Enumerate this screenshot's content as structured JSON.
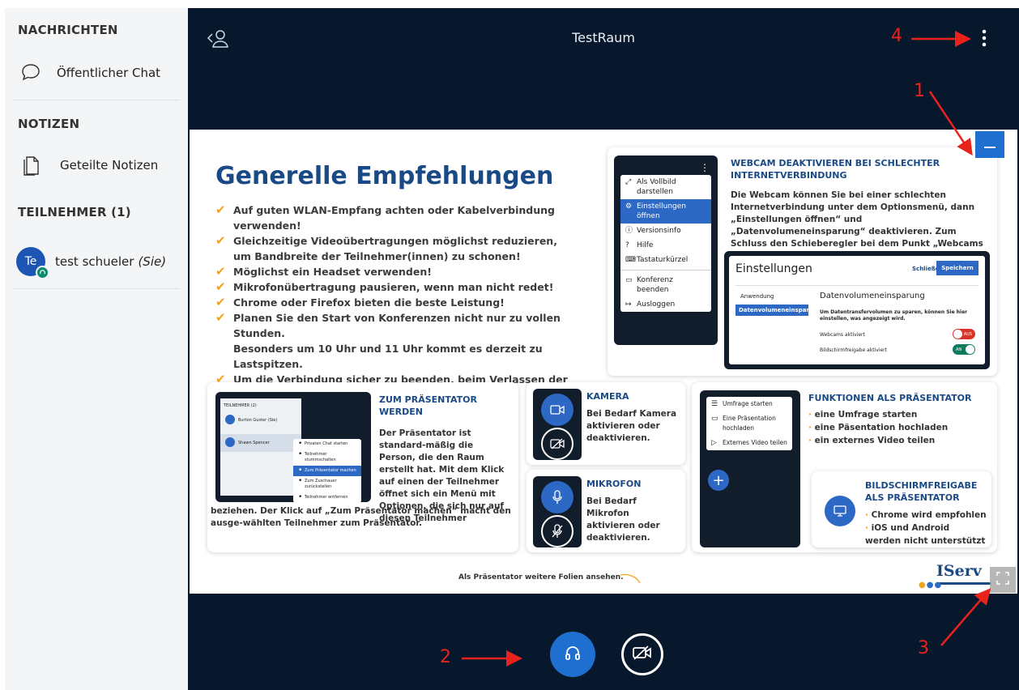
{
  "sidebar": {
    "messages_header": "NACHRICHTEN",
    "public_chat": "Öffentlicher Chat",
    "notes_header": "NOTIZEN",
    "shared_notes": "Geteilte Notizen",
    "participants_header": "TEILNEHMER (1)",
    "user": {
      "initials": "Te",
      "name": "test schueler",
      "you_label": "(Sie)"
    }
  },
  "topbar": {
    "title": "TestRaum"
  },
  "slide": {
    "title": "Generelle Empfehlungen",
    "checklist": [
      "Auf guten WLAN-Empfang achten oder Kabelverbindung verwenden!",
      "Gleichzeitige Videoübertragungen möglichst reduzieren,\num Bandbreite der Teilnehmer(innen) zu schonen!",
      "Möglichst ein Headset verwenden!",
      "Mikrofonübertragung pausieren, wenn man nicht redet!",
      "Chrome oder Firefox bieten die beste Leistung!",
      "Planen Sie den Start von Konferenzen nicht nur zu vollen Stunden.\nBesonders um 10 Uhr und 11 Uhr kommt es derzeit zu Lastspitzen.",
      "Um die Verbindung sicher zu beenden, beim Verlassen der Konferenz\nden Browser-Tab schließen."
    ],
    "webcam_card": {
      "title": "WEBCAM DEAKTIVIEREN BEI SCHLECHTER INTERNETVERBINDUNG",
      "text": "Die Webcam können Sie bei einer schlechten Internetverbindung unter dem Optionsmenü, dann „Einstellungen öffnen“ und „Datenvolumeneinsparung“ deaktivieren. Zum Schluss den Schieberegler bei dem Punkt „Webcams aktiviert“ ausstellen.",
      "menu": [
        "Als Vollbild darstellen",
        "Einstellungen öffnen",
        "Versionsinfo",
        "Hilfe",
        "Tastaturkürzel",
        "Konferenz beenden",
        "Ausloggen"
      ],
      "settings": {
        "title": "Einstellungen",
        "close": "Schließen",
        "save": "Speichern",
        "nav": [
          "Anwendung",
          "Datenvolumeneinspar..."
        ],
        "heading": "Datenvolumeneinsparung",
        "desc": "Um Datentransfervolumen zu sparen, können Sie hier einstellen, was angezeigt wird.",
        "row1": "Webcams aktiviert",
        "row1_state": "AUS",
        "row2": "Bildschirmfreigabe aktiviert",
        "row2_state": "AN"
      }
    },
    "presenter_card": {
      "title": "ZUM PRÄSENTATOR WERDEN",
      "text": "Der Präsentator ist standard-mäßig die Person, die den Raum erstellt hat. Mit dem Klick auf einen der Teilnehmer öffnet sich ein Menü mit Optionen, die sich nur auf diesen Teilnehmer",
      "text2": "beziehen. Der Klick auf „Zum Präsentator machen“ macht den ausge-wählten Teilnehmer zum Präsentator.",
      "mock_header": "TEILNEHMER (2)",
      "mock_users": [
        "Burton Guster (Sie)",
        "Shawn Spencer"
      ],
      "mock_menu": [
        "Privaten Chat starten",
        "Teilnehmer stummschalten",
        "Zum Präsentator machen",
        "Zum Zuschauer zurückstellen",
        "Teilnehmer entfernen"
      ]
    },
    "camera_card": {
      "title": "KAMERA",
      "text": "Bei Bedarf Kamera aktivieren oder deaktivieren."
    },
    "mic_card": {
      "title": "MIKROFON",
      "text": "Bei Bedarf Mikrofon aktivieren oder deaktivieren."
    },
    "functions_card": {
      "title": "FUNKTIONEN ALS PRÄSENTATOR",
      "bullets": [
        "eine Umfrage starten",
        "eine Päsentation hochladen",
        "ein externes Video teilen"
      ],
      "menu": [
        "Umfrage starten",
        "Eine Präsentation hochladen",
        "Externes Video teilen"
      ]
    },
    "screenshare_card": {
      "title": "BILDSCHIRMFREIGABE ALS PRÄSENTATOR",
      "bullets": [
        "Chrome wird empfohlen",
        "iOS und Android werden nicht unterstützt"
      ]
    },
    "footer_note": "Als Präsentator weitere Folien ansehen.",
    "logo": "IServ"
  },
  "annotations": [
    "1",
    "2",
    "3",
    "4"
  ],
  "colors": {
    "accent": "#1e6fd0",
    "dark_bg": "#07182c",
    "sidebar_bg": "#f3f5f7",
    "title_blue": "#1a4a86",
    "check_orange": "#f2a31a",
    "annotation_red": "#e8231b"
  }
}
